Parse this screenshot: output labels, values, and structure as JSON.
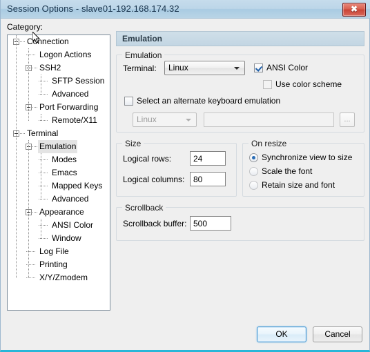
{
  "window": {
    "title": "Session Options - slave01-192.168.174.32",
    "close_label": "✖"
  },
  "category": {
    "label": "Category:",
    "tree": [
      {
        "label": "Connection",
        "depth": 0,
        "expander": "minus",
        "selected": false
      },
      {
        "label": "Logon Actions",
        "depth": 1,
        "expander": "none",
        "selected": false
      },
      {
        "label": "SSH2",
        "depth": 1,
        "expander": "minus",
        "selected": false
      },
      {
        "label": "SFTP Session",
        "depth": 2,
        "expander": "none",
        "selected": false
      },
      {
        "label": "Advanced",
        "depth": 2,
        "expander": "none",
        "selected": false
      },
      {
        "label": "Port Forwarding",
        "depth": 1,
        "expander": "minus",
        "selected": false
      },
      {
        "label": "Remote/X11",
        "depth": 2,
        "expander": "none",
        "selected": false
      },
      {
        "label": "Terminal",
        "depth": 0,
        "expander": "minus",
        "selected": false
      },
      {
        "label": "Emulation",
        "depth": 1,
        "expander": "minus",
        "selected": true
      },
      {
        "label": "Modes",
        "depth": 2,
        "expander": "none",
        "selected": false
      },
      {
        "label": "Emacs",
        "depth": 2,
        "expander": "none",
        "selected": false
      },
      {
        "label": "Mapped Keys",
        "depth": 2,
        "expander": "none",
        "selected": false
      },
      {
        "label": "Advanced",
        "depth": 2,
        "expander": "none",
        "selected": false
      },
      {
        "label": "Appearance",
        "depth": 1,
        "expander": "minus",
        "selected": false
      },
      {
        "label": "ANSI Color",
        "depth": 2,
        "expander": "none",
        "selected": false
      },
      {
        "label": "Window",
        "depth": 2,
        "expander": "none",
        "selected": false
      },
      {
        "label": "Log File",
        "depth": 1,
        "expander": "none",
        "selected": false
      },
      {
        "label": "Printing",
        "depth": 1,
        "expander": "none",
        "selected": false
      },
      {
        "label": "X/Y/Zmodem",
        "depth": 1,
        "expander": "none",
        "selected": false
      }
    ]
  },
  "pane": {
    "header": "Emulation",
    "emulation": {
      "legend": "Emulation",
      "terminal_label": "Terminal:",
      "terminal_value": "Linux",
      "ansi_color_label": "ANSI Color",
      "ansi_color_checked": true,
      "use_color_scheme_label": "Use color scheme",
      "use_color_scheme_checked": false,
      "alt_keyboard_label": "Select an alternate keyboard emulation",
      "alt_keyboard_checked": false,
      "alt_keyboard_value": "Linux",
      "alt_keyboard_path": "",
      "alt_keyboard_path_placeholder": "",
      "browse_label": "..."
    },
    "size": {
      "legend": "Size",
      "rows_label": "Logical rows:",
      "rows_value": "24",
      "cols_label": "Logical columns:",
      "cols_value": "80"
    },
    "on_resize": {
      "legend": "On resize",
      "options": [
        {
          "label": "Synchronize view to size",
          "selected": true
        },
        {
          "label": "Scale the font",
          "selected": false
        },
        {
          "label": "Retain size and font",
          "selected": false
        }
      ]
    },
    "scrollback": {
      "legend": "Scrollback",
      "buffer_label": "Scrollback buffer:",
      "buffer_value": "500"
    }
  },
  "footer": {
    "ok_label": "OK",
    "cancel_label": "Cancel"
  },
  "colors": {
    "titlebar": "#bcd6e8",
    "accent_blue": "#2a6db5",
    "close_red": "#c94335",
    "bottom_edge": "#29b6d8",
    "selection_gray": "#e4e4e4"
  }
}
